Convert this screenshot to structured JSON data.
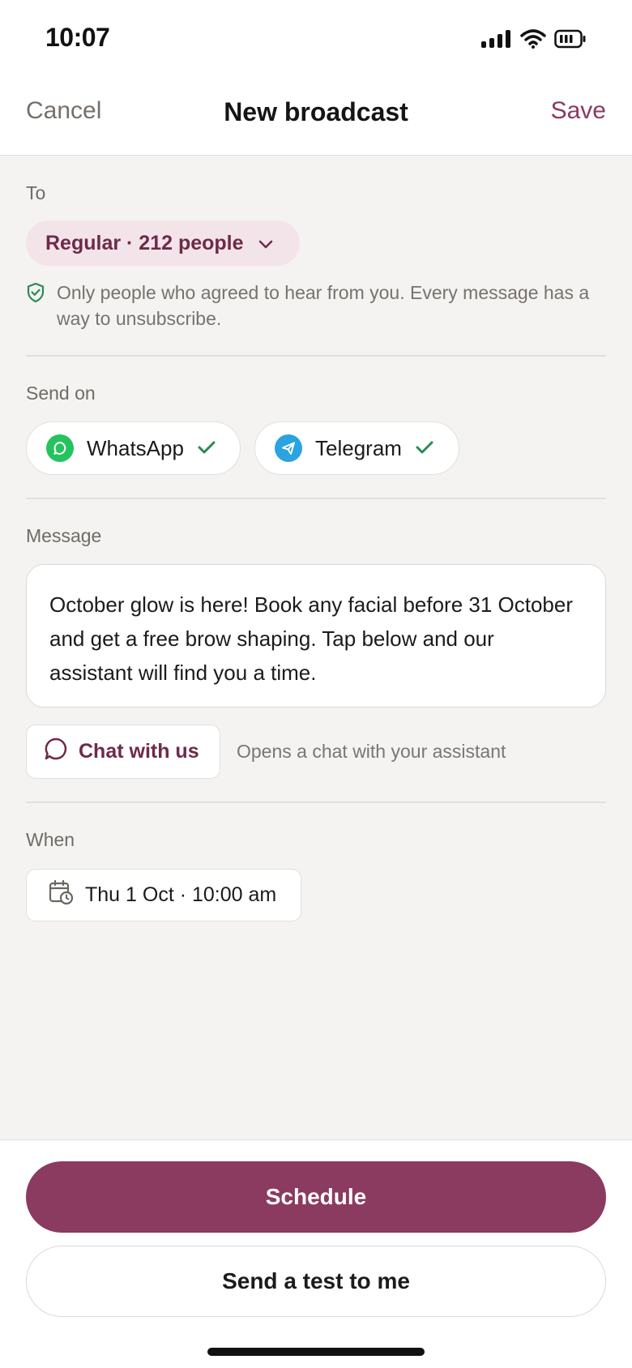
{
  "status_bar": {
    "time": "10:07",
    "icons": [
      "signal-icon",
      "wifi-icon",
      "battery-icon"
    ]
  },
  "nav": {
    "cancel_label": "Cancel",
    "title": "New broadcast",
    "save_label": "Save"
  },
  "to": {
    "label": "To",
    "audience": "Regular · 212 people",
    "consent_note": "Only people who agreed to hear from you. Every message has a way to unsubscribe."
  },
  "send_on": {
    "label": "Send on",
    "channels": [
      {
        "name": "WhatsApp",
        "selected": true,
        "icon": "whatsapp-icon",
        "color": "#25c35f"
      },
      {
        "name": "Telegram",
        "selected": true,
        "icon": "telegram-icon",
        "color": "#2aa3e0"
      }
    ]
  },
  "message": {
    "label": "Message",
    "body": "October glow is here! Book any facial before 31 October and get a free brow shaping. Tap below and our assistant will find you a time.",
    "button_label": "Chat with us",
    "button_hint": "Opens a chat with your assistant"
  },
  "when": {
    "label": "When",
    "value": "Thu 1 Oct · 10:00 am"
  },
  "actions": {
    "primary": "Schedule",
    "secondary": "Send a test to me"
  },
  "colors": {
    "accent": "#8b3a60",
    "accent_soft": "#f3e4ea",
    "check": "#2b8a55",
    "background": "#f4f3f1"
  }
}
